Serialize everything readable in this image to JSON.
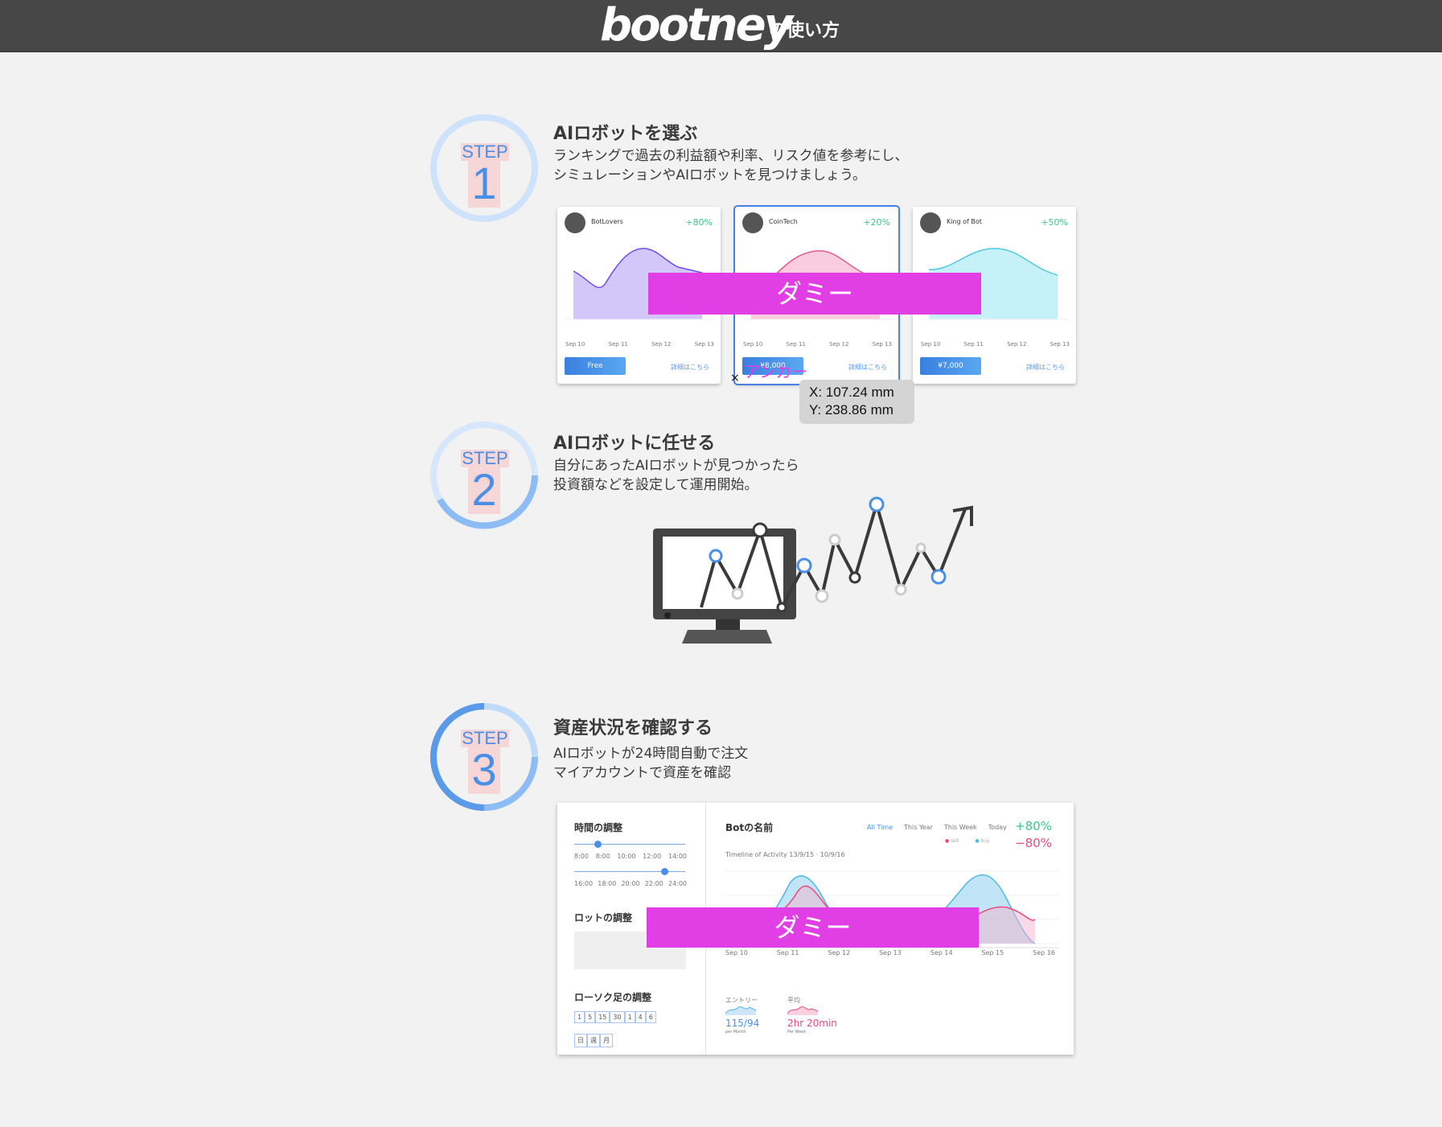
{
  "header": {
    "logo": "bootney",
    "subtitle": "の使い方"
  },
  "steps": [
    {
      "word": "STEP",
      "num": "1",
      "title": "AIロボットを選ぶ",
      "desc": [
        "ランキングで過去の利益額や利率、リスク値を参考にし、",
        "シミュレーションやAIロボットを見つけましょう。"
      ],
      "progress": 0.33
    },
    {
      "word": "STEP",
      "num": "2",
      "title": "AIロボットに任せる",
      "desc": [
        "自分にあったAIロボットが見つかったら",
        "投資額などを設定して運用開始。"
      ],
      "progress": 0.66
    },
    {
      "word": "STEP",
      "num": "3",
      "title": "資産状況を確認する",
      "desc": [
        "AIロボットが24時間自動で注文",
        "マイアカウントで資産を確認"
      ],
      "progress": 1.0
    }
  ],
  "cards": [
    {
      "name": "BotLovers",
      "pct": "+80%",
      "btn": "Free",
      "link": "詳細はこちら",
      "color": "#6a4fe8",
      "fill": "#c8b8f8",
      "dates": [
        "Sep 10",
        "Sep 11",
        "Sep 12",
        "Sep 13"
      ]
    },
    {
      "name": "CoinTech",
      "pct": "+20%",
      "btn": "¥8,000",
      "link": "詳細はこちら",
      "color": "#e8588a",
      "fill": "#f8c0d4",
      "dates": [
        "Sep 10",
        "Sep 11",
        "Sep 12",
        "Sep 13"
      ]
    },
    {
      "name": "King of Bot",
      "pct": "+50%",
      "btn": "¥7,000",
      "link": "詳細はこちら",
      "color": "#4fc8e8",
      "fill": "#b8eef8",
      "dates": [
        "Sep 10",
        "Sep 11",
        "Sep 12",
        "Sep 13"
      ]
    }
  ],
  "dummy_label": "ダミー",
  "anchor_label": "アンカー",
  "coord": {
    "x": "X: 107.24 mm",
    "y": "Y: 238.86 mm"
  },
  "panel": {
    "time_title": "時間の調整",
    "time_row1": [
      "8:00",
      "8:00",
      "10:00",
      "12:00",
      "14:00"
    ],
    "time_row2": [
      "16:00",
      "18:00",
      "20:00",
      "22:00",
      "24:00"
    ],
    "lot_title": "ロットの調整",
    "candle_title": "ローソク足の調整",
    "candle_opts1": [
      "1",
      "5",
      "15",
      "30",
      "1",
      "4",
      "6"
    ],
    "candle_opts2": [
      "日",
      "週",
      "月"
    ],
    "bot_name": "Botの名前",
    "filters": [
      "All Time",
      "This Year",
      "This Week",
      "Today"
    ],
    "gain": "+80%",
    "loss": "−80%",
    "legend": [
      "sell",
      "buy"
    ],
    "timeline": "Timeline of Activity 13/9/15 · 10/9/16",
    "dates": [
      "Sep 10",
      "Sep 11",
      "Sep 12",
      "Sep 13",
      "Sep 14",
      "Sep 15",
      "Sep 16"
    ],
    "entry_label": "エントリー",
    "entry_value": "115/94",
    "entry_sub": "per Month",
    "time_label": "平均",
    "time_value": "2hr 20min",
    "time_sub": "Per Week"
  }
}
